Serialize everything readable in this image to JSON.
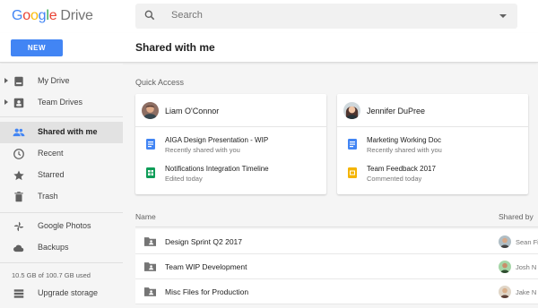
{
  "app": {
    "logo_word": "Google",
    "logo_product": "Drive"
  },
  "search": {
    "placeholder": "Search"
  },
  "toolbar": {
    "new_label": "NEW",
    "page_title": "Shared with me"
  },
  "sidebar": {
    "items": [
      {
        "label": "My Drive",
        "icon": "my-drive-icon",
        "expandable": true
      },
      {
        "label": "Team Drives",
        "icon": "team-drives-icon",
        "expandable": true
      },
      {
        "label": "Shared with me",
        "icon": "people-icon",
        "active": true
      },
      {
        "label": "Recent",
        "icon": "clock-icon"
      },
      {
        "label": "Starred",
        "icon": "star-icon"
      },
      {
        "label": "Trash",
        "icon": "trash-icon"
      },
      {
        "label": "Google Photos",
        "icon": "photos-pinwheel-icon"
      },
      {
        "label": "Backups",
        "icon": "cloud-icon"
      }
    ],
    "storage_text": "10.5 GB of 100.7 GB used",
    "storage_fraction": 0.104,
    "upgrade_label": "Upgrade storage"
  },
  "quick_access": {
    "label": "Quick Access",
    "cards": [
      {
        "person": "Liam O'Connor",
        "files": [
          {
            "title": "AIGA Design Presentation - WIP",
            "subtitle": "Recently shared with you",
            "type": "doc"
          },
          {
            "title": "Notifications Integration Timeline",
            "subtitle": "Edited today",
            "type": "sheet"
          }
        ]
      },
      {
        "person": "Jennifer DuPree",
        "files": [
          {
            "title": "Marketing Working Doc",
            "subtitle": "Recently shared with you",
            "type": "doc"
          },
          {
            "title": "Team Feedback 2017",
            "subtitle": "Commented today",
            "type": "slides"
          }
        ]
      }
    ]
  },
  "file_list": {
    "col_name": "Name",
    "col_shared_by": "Shared by",
    "rows": [
      {
        "name": "Design Sprint Q2 2017",
        "shared_by": "Sean Fi"
      },
      {
        "name": "Team WIP Development",
        "shared_by": "Josh N"
      },
      {
        "name": "Misc Files for Production",
        "shared_by": "Jake N"
      }
    ]
  },
  "colors": {
    "accent": "#4285f4",
    "doc": "#4285f4",
    "sheet": "#0f9d58",
    "slides": "#f4b400",
    "sidebar_active": "#e2e2e2"
  }
}
